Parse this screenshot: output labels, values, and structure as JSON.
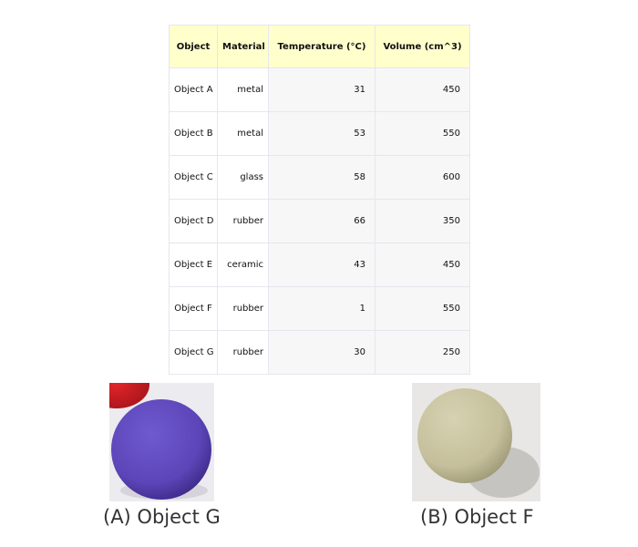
{
  "table": {
    "headers": [
      "Object",
      "Material",
      "Temperature (°C)",
      "Volume (cm^3)"
    ],
    "rows": [
      [
        "Object A",
        "metal",
        "31",
        "450"
      ],
      [
        "Object B",
        "metal",
        "53",
        "550"
      ],
      [
        "Object C",
        "glass",
        "58",
        "600"
      ],
      [
        "Object D",
        "rubber",
        "66",
        "350"
      ],
      [
        "Object E",
        "ceramic",
        "43",
        "450"
      ],
      [
        "Object F",
        "rubber",
        "1",
        "550"
      ],
      [
        "Object G",
        "rubber",
        "30",
        "250"
      ]
    ]
  },
  "images": [
    {
      "caption": "(A) Object G",
      "ball_color": "#5b45b8"
    },
    {
      "caption": "(B) Object F",
      "ball_color": "#c8c3a0"
    }
  ],
  "colors": {
    "header_bg": "#ffffcc",
    "cell_bg": "#f7f7f8",
    "grid": "#e6e6ee"
  }
}
